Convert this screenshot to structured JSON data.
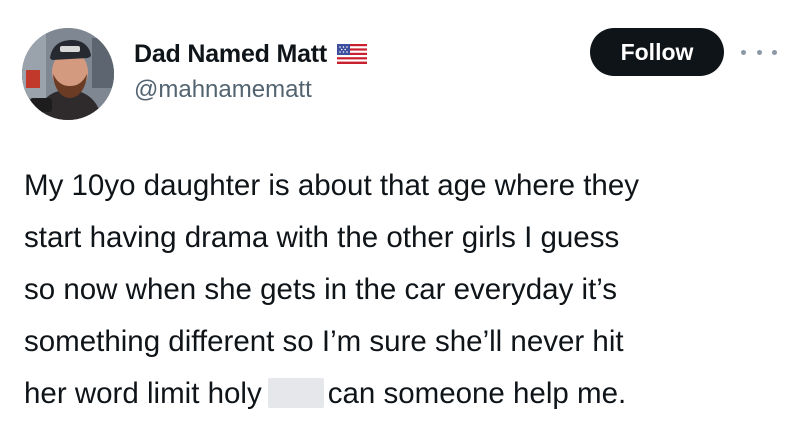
{
  "author": {
    "display_name": "Dad Named Matt",
    "handle": "@mahnamematt",
    "avatar_icon": "user-avatar-photo",
    "flag_icon": "us-flag-icon"
  },
  "actions": {
    "follow_label": "Follow",
    "more_icon": "more-options-icon"
  },
  "tweet": {
    "lines": [
      "My 10yo daughter is about that age where they",
      "start having drama with the other girls I guess",
      "so now when she gets in the car everyday it’s",
      "something different so I’m sure she’ll never hit"
    ],
    "last_line_before": "her word limit holy",
    "last_line_after": "can someone help me."
  },
  "colors": {
    "text_primary": "#0f1419",
    "text_secondary": "#536471",
    "follow_bg": "#0f1419",
    "follow_text": "#ffffff",
    "censor_block": "#e5e7ea"
  }
}
